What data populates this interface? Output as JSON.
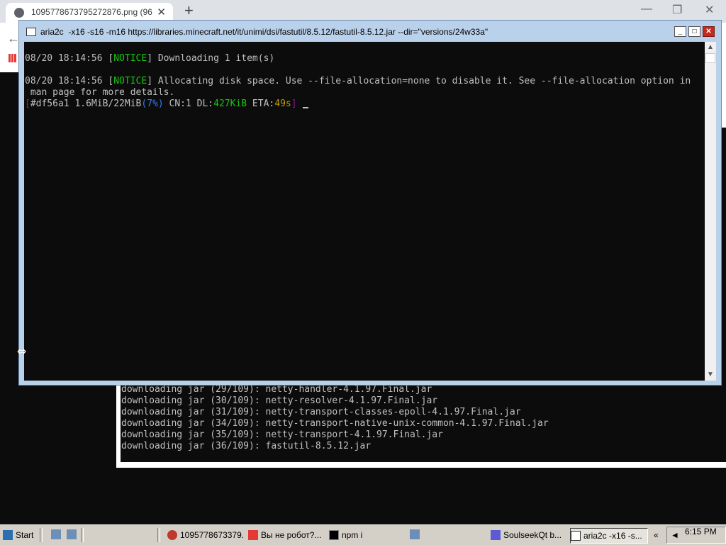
{
  "browser": {
    "tab_title": "1095778673795272876.png (96",
    "tab_close": "✕",
    "new_tab": "+",
    "minimize": "—",
    "restore": "❐",
    "close": "✕"
  },
  "back_console": {
    "lines": [
      "downloading jar (29/109): netty-handler-4.1.97.Final.jar",
      "downloading jar (30/109): netty-resolver-4.1.97.Final.jar",
      "downloading jar (31/109): netty-transport-classes-epoll-4.1.97.Final.jar",
      "downloading jar (34/109): netty-transport-native-unix-common-4.1.97.Final.jar",
      "downloading jar (35/109): netty-transport-4.1.97.Final.jar",
      "downloading jar (36/109): fastutil-8.5.12.jar"
    ]
  },
  "aria_window": {
    "title": "aria2c  -x16 -s16 -m16 https://libraries.minecraft.net/it/unimi/dsi/fastutil/8.5.12/fastutil-8.5.12.jar --dir=\"versions/24w33a\"",
    "btn_min": "_",
    "btn_max": "□",
    "btn_close": "✕",
    "console": {
      "l1_time": "08/20 18:14:56 [",
      "l1_tag": "NOTICE",
      "l1_msg": "] Downloading 1 item(s)",
      "l2_time": "08/20 18:14:56 [",
      "l2_tag": "NOTICE",
      "l2_msg": "] Allocating disk space. Use --file-allocation=none to disable it. See --file-allocation option in",
      "l3": " man page for more details.",
      "p_open": "[",
      "p_id": "#df56a1 1.6MiB/22MiB",
      "p_pct": "(7%)",
      "p_cn": " CN:1 DL:",
      "p_dl": "427KiB",
      "p_eta_label": " ETA:",
      "p_eta": "49s",
      "p_close": "]"
    },
    "scroll_up": "▲",
    "scroll_down": "▼"
  },
  "taskbar": {
    "start": "Start",
    "tasks": [
      "1095778673379...",
      "Вы не робот?...",
      "npm i",
      "SoulseekQt b...",
      "aria2c  -x16 -s..."
    ],
    "tray_arrow": "«",
    "clock": "6:15 PM"
  }
}
